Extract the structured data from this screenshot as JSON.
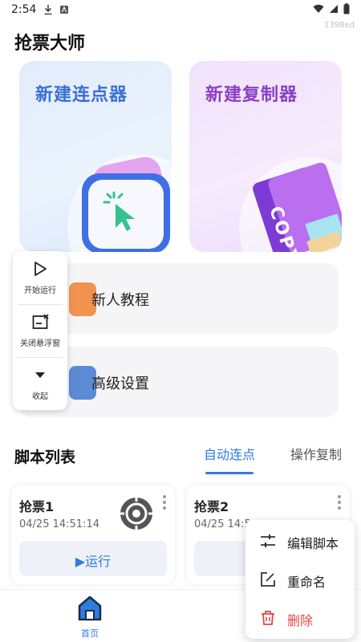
{
  "status_bar": {
    "time": "2:54",
    "watermark": "1398ed"
  },
  "app": {
    "title": "抢票大师"
  },
  "cards": {
    "new_clicker": "新建连点器",
    "new_copier": "新建复制器",
    "copy_badge": "COPY"
  },
  "list": {
    "tutorial": "新人教程",
    "advanced": "高级设置"
  },
  "float_panel": {
    "start": "开始运行",
    "close": "关闭悬浮窗",
    "collapse": "收起"
  },
  "section": {
    "title": "脚本列表",
    "tab_auto": "自动连点",
    "tab_copy": "操作复制"
  },
  "scripts": [
    {
      "name": "抢票1",
      "time": "04/25 14:51:14",
      "run": "运行"
    },
    {
      "name": "抢票2",
      "time": "04/25 14:5",
      "run": ""
    }
  ],
  "nav": {
    "home": "首页"
  },
  "context_menu": {
    "edit": "编辑脚本",
    "rename": "重命名",
    "delete": "删除"
  },
  "colors": {
    "accent": "#2f7be0",
    "delete": "#e24848",
    "clicker_title": "#3b6fd4",
    "copier_title": "#8a3fc4"
  }
}
